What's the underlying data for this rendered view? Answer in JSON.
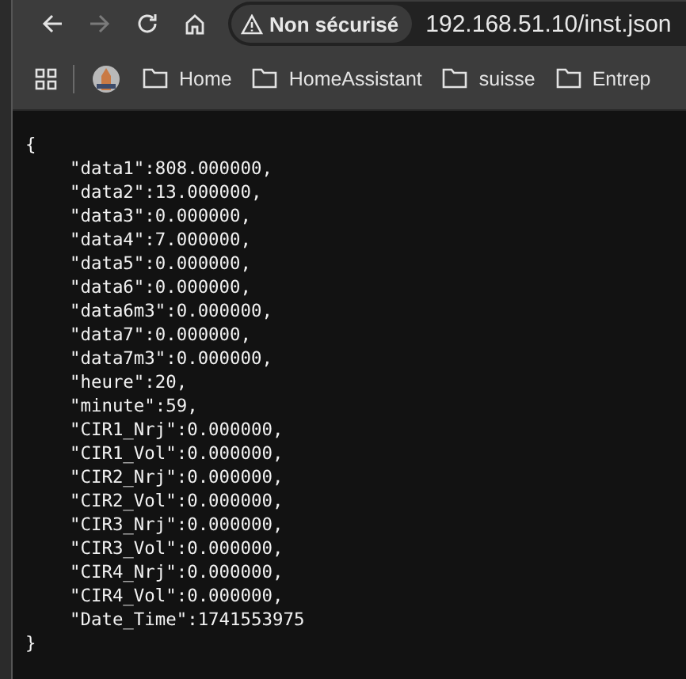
{
  "toolbar": {
    "back_disabled": false,
    "forward_disabled": true
  },
  "address_bar": {
    "security_label": "Non sécurisé",
    "url": "192.168.51.10/inst.json"
  },
  "bookmarks": [
    {
      "kind": "site"
    },
    {
      "kind": "folder",
      "label": "Home"
    },
    {
      "kind": "folder",
      "label": "HomeAssistant"
    },
    {
      "kind": "folder",
      "label": "suisse"
    },
    {
      "kind": "folder",
      "label": "Entrep"
    }
  ],
  "json_view": {
    "open": "{",
    "entries": [
      "\"data1\":808.000000,",
      "\"data2\":13.000000,",
      "\"data3\":0.000000,",
      "\"data4\":7.000000,",
      "\"data5\":0.000000,",
      "\"data6\":0.000000,",
      "\"data6m3\":0.000000,",
      "\"data7\":0.000000,",
      "\"data7m3\":0.000000,",
      "\"heure\":20,",
      "\"minute\":59,",
      "\"CIR1_Nrj\":0.000000,",
      "\"CIR1_Vol\":0.000000,",
      "\"CIR2_Nrj\":0.000000,",
      "\"CIR2_Vol\":0.000000,",
      "\"CIR3_Nrj\":0.000000,",
      "\"CIR3_Vol\":0.000000,",
      "\"CIR4_Nrj\":0.000000,",
      "\"CIR4_Vol\":0.000000,",
      "\"Date_Time\":1741553975"
    ],
    "close": "}"
  }
}
